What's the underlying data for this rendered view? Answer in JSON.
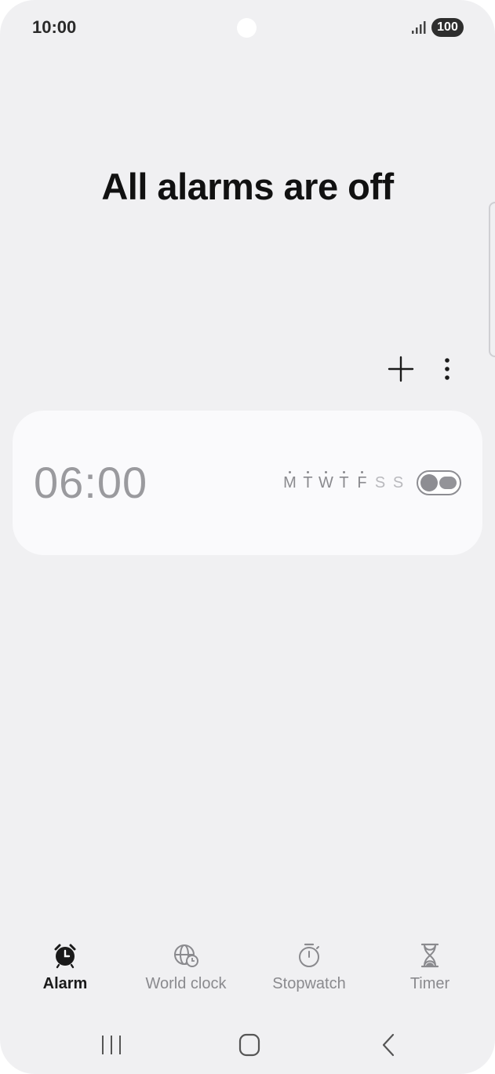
{
  "status_bar": {
    "time": "10:00",
    "battery": "100",
    "icons": [
      "signal-icon",
      "battery-icon"
    ]
  },
  "page_title": "All alarms are off",
  "toolbar": {
    "icons": [
      "add-icon",
      "more-options-icon"
    ]
  },
  "alarm": {
    "time": "06:00",
    "enabled": false,
    "days": [
      {
        "letter": "M",
        "selected": true
      },
      {
        "letter": "T",
        "selected": true
      },
      {
        "letter": "W",
        "selected": true
      },
      {
        "letter": "T",
        "selected": true
      },
      {
        "letter": "F",
        "selected": true
      },
      {
        "letter": "S",
        "selected": false
      },
      {
        "letter": "S",
        "selected": false
      }
    ]
  },
  "tabs": [
    {
      "label": "Alarm",
      "icon": "alarm-clock-icon",
      "active": true
    },
    {
      "label": "World clock",
      "icon": "globe-clock-icon",
      "active": false
    },
    {
      "label": "Stopwatch",
      "icon": "stopwatch-icon",
      "active": false
    },
    {
      "label": "Timer",
      "icon": "hourglass-icon",
      "active": false
    }
  ],
  "colors": {
    "background": "#f0f0f2",
    "card": "#fafafc",
    "active_text": "#1a1a1a",
    "inactive_text": "#8a8a8e"
  },
  "nav_bar": {
    "icons": [
      "recent-apps-icon",
      "home-icon",
      "back-icon"
    ]
  }
}
